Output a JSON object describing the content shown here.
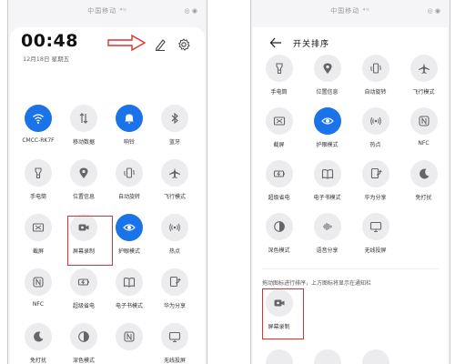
{
  "left_phone": {
    "status_text": "中国移动 ⁴ᴳ ",
    "status_right": "◎ ◉",
    "clock": "00:48",
    "date": "12月18日 星期五",
    "tiles": [
      {
        "label": "CMCC-RK7F",
        "icon": "wifi-icon",
        "on": true
      },
      {
        "label": "移动数据",
        "icon": "mobile-data-icon",
        "on": false
      },
      {
        "label": "响铃",
        "icon": "bell-icon",
        "on": true
      },
      {
        "label": "蓝牙",
        "icon": "bluetooth-icon",
        "on": false
      },
      {
        "label": "手电筒",
        "icon": "flashlight-icon",
        "on": false
      },
      {
        "label": "位置信息",
        "icon": "location-icon",
        "on": false
      },
      {
        "label": "自动旋转",
        "icon": "rotate-icon",
        "on": false
      },
      {
        "label": "飞行模式",
        "icon": "airplane-icon",
        "on": false
      },
      {
        "label": "截屏",
        "icon": "screenshot-icon",
        "on": false
      },
      {
        "label": "屏幕录制",
        "icon": "screen-record-icon",
        "on": false
      },
      {
        "label": "护眼模式",
        "icon": "eye-icon",
        "on": true
      },
      {
        "label": "热点",
        "icon": "hotspot-icon",
        "on": false
      },
      {
        "label": "NFC",
        "icon": "nfc-icon",
        "on": false
      },
      {
        "label": "超级省电",
        "icon": "battery-icon",
        "on": false
      },
      {
        "label": "电子书模式",
        "icon": "ebook-icon",
        "on": false
      },
      {
        "label": "华为分享",
        "icon": "share-icon",
        "on": false
      },
      {
        "label": "免打扰",
        "icon": "moon-icon",
        "on": false
      },
      {
        "label": "深色模式",
        "icon": "dark-mode-icon",
        "on": false
      },
      {
        "label": "",
        "icon": "nfc-icon",
        "on": false
      },
      {
        "label": "无线投屏",
        "icon": "cast-icon",
        "on": false
      }
    ]
  },
  "right_phone": {
    "status_text": "中国移动 ⁴ᴳ ",
    "status_right": "◎ ◉",
    "title": "开关排序",
    "tiles": [
      {
        "label": "手电筒",
        "icon": "flashlight-icon",
        "on": false
      },
      {
        "label": "位置信息",
        "icon": "location-icon",
        "on": false
      },
      {
        "label": "自动旋转",
        "icon": "rotate-icon",
        "on": false
      },
      {
        "label": "飞行模式",
        "icon": "airplane-icon",
        "on": false
      },
      {
        "label": "截屏",
        "icon": "screenshot-icon",
        "on": false
      },
      {
        "label": "护眼模式",
        "icon": "eye-icon",
        "on": true
      },
      {
        "label": "热点",
        "icon": "hotspot-icon",
        "on": false
      },
      {
        "label": "NFC",
        "icon": "nfc-icon",
        "on": false
      },
      {
        "label": "超级省电",
        "icon": "battery-icon",
        "on": false
      },
      {
        "label": "电子书模式",
        "icon": "ebook-icon",
        "on": false
      },
      {
        "label": "华为分享",
        "icon": "share-icon",
        "on": false
      },
      {
        "label": "免打扰",
        "icon": "moon-icon",
        "on": false
      },
      {
        "label": "深色模式",
        "icon": "dark-mode-icon",
        "on": false
      },
      {
        "label": "语音分享",
        "icon": "voice-icon",
        "on": false
      },
      {
        "label": "无线投屏",
        "icon": "cast-icon",
        "on": false
      }
    ],
    "hint": "拖动图标进行排序，上方图标将显示在通知栏",
    "spare_tiles": [
      {
        "label": "屏幕录制",
        "icon": "screen-record-icon",
        "on": false
      }
    ]
  },
  "colors": {
    "accent": "#1a73e8",
    "highlight": "#e0312f",
    "tile_bg": "#ececef"
  }
}
